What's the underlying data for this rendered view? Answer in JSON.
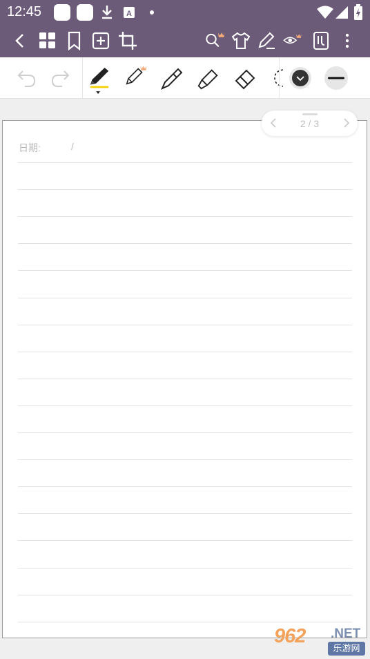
{
  "status_bar": {
    "time": "12:45",
    "icons": [
      "app-square-icon",
      "app-square-icon",
      "download-icon",
      "a-icon",
      "dot-icon",
      "wifi-icon",
      "signal-icon",
      "battery-icon"
    ]
  },
  "app_bar": {
    "icons": [
      "back-icon",
      "grid-icon",
      "bookmark-icon",
      "add-page-icon",
      "crop-icon",
      "search-icon",
      "shirt-icon",
      "pen-edit-icon",
      "eye-icon",
      "template-icon",
      "more-icon"
    ]
  },
  "toolbar": {
    "tools": [
      "undo-icon",
      "redo-icon",
      "fountain-pen-icon",
      "pencil-icon",
      "ballpoint-icon",
      "highlighter-icon",
      "eraser-icon",
      "lasso-icon",
      "color-icon",
      "stroke-width-icon"
    ],
    "active_tool": "fountain-pen-icon"
  },
  "page": {
    "date_label": "日期:",
    "date_separator": "/",
    "line_count": 18
  },
  "pager": {
    "label": "2 / 3"
  },
  "watermark": {
    "number": "962",
    "suffix": ".NET",
    "cn": "乐游网"
  },
  "colors": {
    "bar": "#6b5b78",
    "crown": "#f2a97a",
    "accent_underline": "#f5d000"
  }
}
